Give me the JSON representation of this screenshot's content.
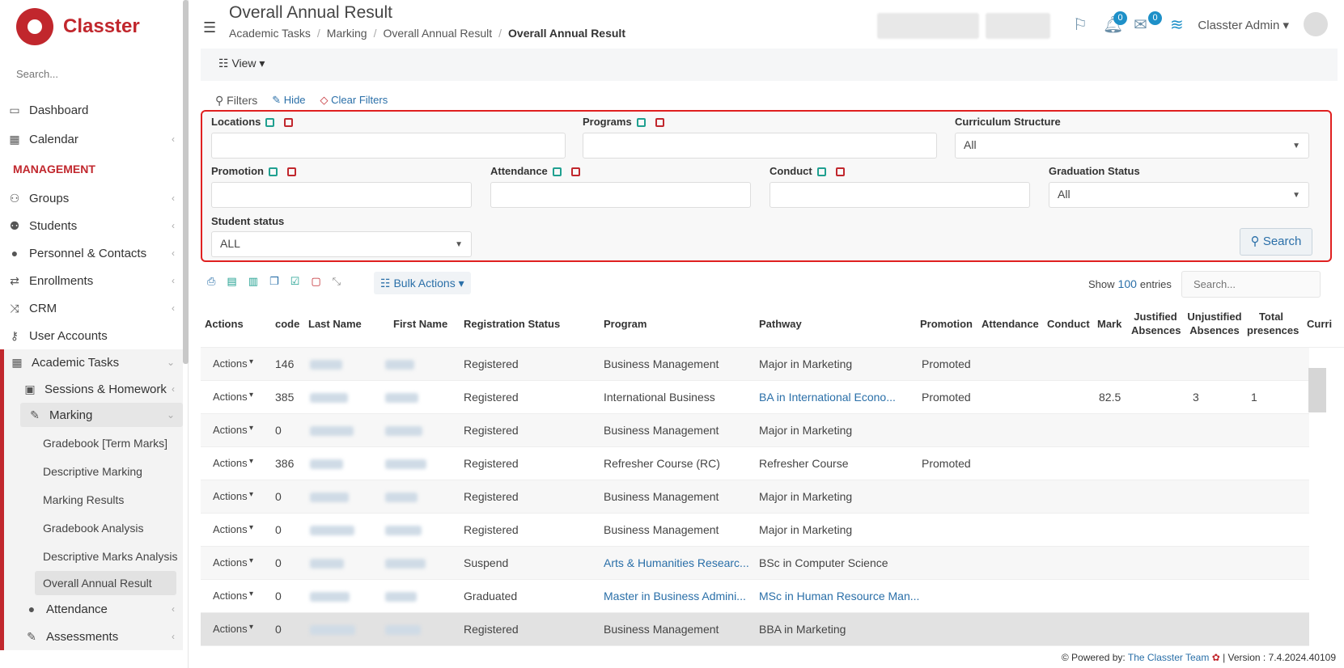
{
  "app": {
    "name": "Classter"
  },
  "sidebar": {
    "search_placeholder": "Search...",
    "top_items": [
      {
        "label": "Dashboard"
      },
      {
        "label": "Calendar"
      }
    ],
    "section_title": "MANAGEMENT",
    "items": [
      {
        "label": "Groups"
      },
      {
        "label": "Students"
      },
      {
        "label": "Personnel & Contacts"
      },
      {
        "label": "Enrollments"
      },
      {
        "label": "CRM"
      },
      {
        "label": "User Accounts"
      },
      {
        "label": "Academic Tasks"
      }
    ],
    "academic_sub": [
      {
        "label": "Sessions & Homework"
      },
      {
        "label": "Marking"
      }
    ],
    "marking_sub": [
      {
        "label": "Gradebook [Term Marks]"
      },
      {
        "label": "Descriptive Marking"
      },
      {
        "label": "Marking Results"
      },
      {
        "label": "Gradebook Analysis"
      },
      {
        "label": "Descriptive Marks Analysis"
      },
      {
        "label": "Overall Annual Result"
      }
    ],
    "after_items": [
      {
        "label": "Attendance"
      },
      {
        "label": "Assessments"
      }
    ]
  },
  "header": {
    "title": "Overall Annual Result",
    "breadcrumb": [
      "Academic Tasks",
      "Marking",
      "Overall Annual Result",
      "Overall Annual Result"
    ],
    "notifications_count": "0",
    "messages_count": "0",
    "user_name": "Classter Admin"
  },
  "viewbar": {
    "view_label": "View"
  },
  "filters": {
    "title": "Filters",
    "hide": "Hide",
    "clear": "Clear Filters",
    "locations": "Locations",
    "programs": "Programs",
    "curriculum": "Curriculum Structure",
    "curriculum_value": "All",
    "promotion": "Promotion",
    "attendance": "Attendance",
    "conduct": "Conduct",
    "graduation": "Graduation Status",
    "graduation_value": "All",
    "student_status": "Student status",
    "student_status_value": "ALL",
    "search_button": "Search"
  },
  "table_toolbar": {
    "bulk_actions": "Bulk Actions",
    "show": "Show",
    "entries_count": "100",
    "entries": "entries",
    "search_placeholder": "Search..."
  },
  "table": {
    "columns": [
      "Actions",
      "code",
      "Last Name",
      "First Name",
      "Registration Status",
      "Program",
      "Pathway",
      "Promotion",
      "Attendance",
      "Conduct",
      "Mark",
      "Justified Absences",
      "Unjustified Absences",
      "Total presences",
      "Curri"
    ],
    "rows": [
      {
        "actions": "Actions",
        "code": "146",
        "status": "Registered",
        "program": "Business Management",
        "pathway": "Major in Marketing",
        "promotion": "Promoted",
        "mark": "",
        "unjust": "",
        "total": ""
      },
      {
        "actions": "Actions",
        "code": "385",
        "status": "Registered",
        "program": "International Business",
        "pathway": "BA in International Econo...",
        "promotion": "Promoted",
        "mark": "82.5",
        "unjust": "3",
        "total": "1"
      },
      {
        "actions": "Actions",
        "code": "0",
        "status": "Registered",
        "program": "Business Management",
        "pathway": "Major in Marketing",
        "promotion": "",
        "mark": "",
        "unjust": "",
        "total": ""
      },
      {
        "actions": "Actions",
        "code": "386",
        "status": "Registered",
        "program": "Refresher Course (RC)",
        "pathway": "Refresher Course",
        "promotion": "Promoted",
        "mark": "",
        "unjust": "",
        "total": ""
      },
      {
        "actions": "Actions",
        "code": "0",
        "status": "Registered",
        "program": "Business Management",
        "pathway": "Major in Marketing",
        "promotion": "",
        "mark": "",
        "unjust": "",
        "total": ""
      },
      {
        "actions": "Actions",
        "code": "0",
        "status": "Registered",
        "program": "Business Management",
        "pathway": "Major in Marketing",
        "promotion": "",
        "mark": "",
        "unjust": "",
        "total": ""
      },
      {
        "actions": "Actions",
        "code": "0",
        "status": "Suspend",
        "program": "Arts & Humanities Researc...",
        "pathway": "BSc in Computer Science",
        "promotion": "",
        "mark": "",
        "unjust": "",
        "total": ""
      },
      {
        "actions": "Actions",
        "code": "0",
        "status": "Graduated",
        "program": "Master in Business Admini...",
        "pathway": "MSc in Human Resource Man...",
        "promotion": "",
        "mark": "",
        "unjust": "",
        "total": ""
      },
      {
        "actions": "Actions",
        "code": "0",
        "status": "Registered",
        "program": "Business Management",
        "pathway": "BBA in Marketing",
        "promotion": "",
        "mark": "",
        "unjust": "",
        "total": ""
      }
    ]
  },
  "footer": {
    "powered": "Powered by:",
    "team": "The Classter Team",
    "version": "| Version : 7.4.2024.40109"
  }
}
